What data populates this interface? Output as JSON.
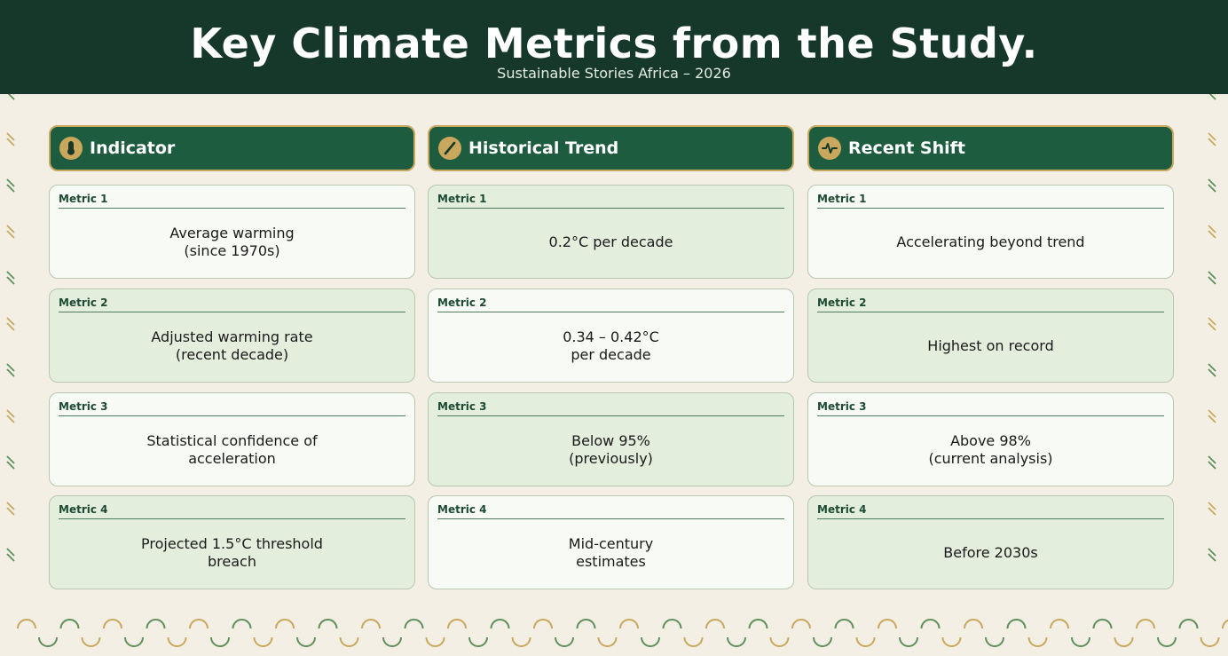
{
  "header": {
    "title": "Key Climate Metrics from the Study.",
    "subtitle": "Sustainable Stories Africa – 2026"
  },
  "colors": {
    "header_bg": "#16382a",
    "column_header_bg": "#1d5c3f",
    "accent_gold": "#c9a85e",
    "card_light": "#f8faf5",
    "card_green": "#e3eedd",
    "page_bg": "#f3efe4"
  },
  "columns": [
    {
      "label": "Indicator",
      "icon": "thermometer-icon",
      "cards": [
        {
          "tag": "Metric 1",
          "value": "Average warming\n(since 1970s)"
        },
        {
          "tag": "Metric 2",
          "value": "Adjusted warming rate\n(recent decade)"
        },
        {
          "tag": "Metric 3",
          "value": "Statistical confidence of\nacceleration"
        },
        {
          "tag": "Metric 4",
          "value": "Projected 1.5°C threshold\nbreach"
        }
      ]
    },
    {
      "label": "Historical Trend",
      "icon": "trend-line-icon",
      "cards": [
        {
          "tag": "Metric 1",
          "value": "0.2°C per decade"
        },
        {
          "tag": "Metric 2",
          "value": "0.34 – 0.42°C\nper decade"
        },
        {
          "tag": "Metric 3",
          "value": "Below 95%\n(previously)"
        },
        {
          "tag": "Metric 4",
          "value": "Mid-century\nestimates"
        }
      ]
    },
    {
      "label": "Recent Shift",
      "icon": "pulse-icon",
      "cards": [
        {
          "tag": "Metric 1",
          "value": "Accelerating beyond trend"
        },
        {
          "tag": "Metric 2",
          "value": "Highest on record"
        },
        {
          "tag": "Metric 3",
          "value": "Above 98%\n(current analysis)"
        },
        {
          "tag": "Metric 4",
          "value": "Before 2030s"
        }
      ]
    }
  ]
}
